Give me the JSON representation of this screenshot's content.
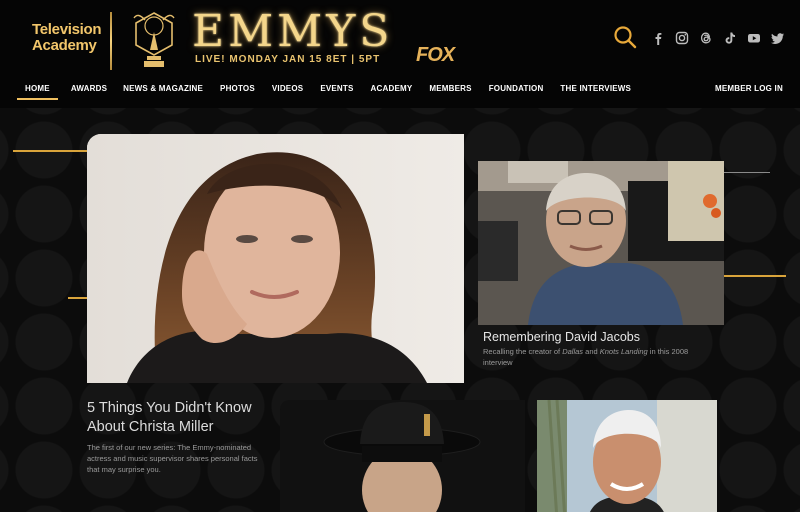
{
  "header": {
    "academy_logo": [
      "Television",
      "Academy"
    ],
    "emmys_title": "EMMYS",
    "broadcast_line": "LIVE! MONDAY JAN 15 8ET | 5PT",
    "network_logo": "FOX"
  },
  "social_icons": [
    "facebook-icon",
    "instagram-icon",
    "threads-icon",
    "tiktok-icon",
    "youtube-icon",
    "twitter-icon"
  ],
  "nav": {
    "items": [
      "HOME",
      "AWARDS",
      "NEWS & MAGAZINE",
      "PHOTOS",
      "VIDEOS",
      "EVENTS",
      "ACADEMY",
      "MEMBERS",
      "FOUNDATION",
      "THE INTERVIEWS"
    ],
    "active": "HOME",
    "member_login": "MEMBER LOG IN"
  },
  "articles": [
    {
      "headline": "5 Things You Didn't Know About Christa Miller",
      "dek": "The first of our new series: The Emmy-nominated actress and music supervisor shares personal facts that may surprise you."
    },
    {
      "headline": "Remembering David Jacobs",
      "dek_parts": [
        "Recalling the creator of ",
        "Dallas",
        " and ",
        "Knots Landing",
        " in this 2008 interview"
      ]
    }
  ],
  "colors": {
    "accent_gold": "#d9a43b",
    "logo_gold": "#f2c66b",
    "background": "#0b0b0b"
  }
}
